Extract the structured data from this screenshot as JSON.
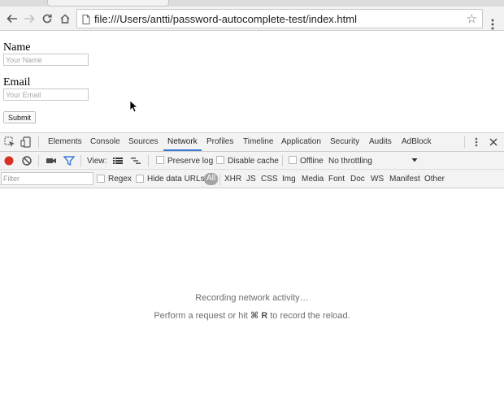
{
  "browser": {
    "url": "file:///Users/antti/password-autocomplete-test/index.html"
  },
  "form": {
    "name_label": "Name",
    "name_placeholder": "Your Name",
    "email_label": "Email",
    "email_placeholder": "Your Email",
    "submit_label": "Submit"
  },
  "devtools": {
    "tabs": [
      "Elements",
      "Console",
      "Sources",
      "Network",
      "Profiles",
      "Timeline",
      "Application",
      "Security",
      "Audits",
      "AdBlock"
    ],
    "active_tab": "Network",
    "toolbar": {
      "view_label": "View:",
      "preserve_log": "Preserve log",
      "disable_cache": "Disable cache",
      "offline": "Offline",
      "throttling": "No throttling"
    },
    "filter": {
      "placeholder": "Filter",
      "regex": "Regex",
      "hide_data_urls": "Hide data URLs",
      "types": [
        "All",
        "XHR",
        "JS",
        "CSS",
        "Img",
        "Media",
        "Font",
        "Doc",
        "WS",
        "Manifest",
        "Other"
      ]
    },
    "empty": {
      "line1": "Recording network activity…",
      "line2_prefix": "Perform a request or hit",
      "line2_key": "⌘ R",
      "line2_suffix": "to record the reload."
    }
  },
  "colors": {
    "record": "#d93025",
    "filter_icon": "#3879d9",
    "active_tab_underline": "#3879d9"
  }
}
